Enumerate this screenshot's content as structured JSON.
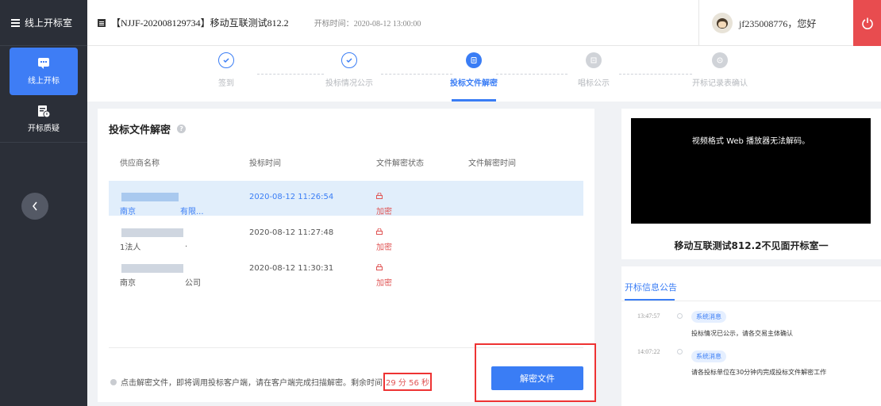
{
  "sidebar": {
    "header_label": "线上开标室",
    "items": [
      {
        "label": "线上开标"
      },
      {
        "label": "开标质疑"
      }
    ]
  },
  "topbar": {
    "project_title": "【NJJF-202008129734】移动互联测试812.2",
    "open_time_label": "开标时间：",
    "open_time_value": "2020-08-12 13:00:00",
    "user_greeting": "jf235008776，您好"
  },
  "steps": [
    {
      "label": "签到",
      "state": "done"
    },
    {
      "label": "投标情况公示",
      "state": "done"
    },
    {
      "label": "投标文件解密",
      "state": "current"
    },
    {
      "label": "唱标公示",
      "state": "todo"
    },
    {
      "label": "开标记录表确认",
      "state": "todo"
    }
  ],
  "panel": {
    "title": "投标文件解密",
    "columns": [
      "供应商名称",
      "投标时间",
      "文件解密状态",
      "文件解密时间"
    ],
    "rows": [
      {
        "name_prefix": "南京",
        "name_suffix": "有限...",
        "bid_time": "2020-08-12 11:26:54",
        "status": "加密",
        "decrypt_time": ""
      },
      {
        "name_prefix": "1法人",
        "name_suffix": ".",
        "bid_time": "2020-08-12 11:27:48",
        "status": "加密",
        "decrypt_time": ""
      },
      {
        "name_prefix": "南京",
        "name_suffix": "公司",
        "bid_time": "2020-08-12 11:30:31",
        "status": "加密",
        "decrypt_time": ""
      }
    ],
    "hint_text": "点击解密文件，即将调用投标客户端，请在客户端完成扫描解密。剩余时间",
    "countdown": "29 分 56 秒",
    "decrypt_button": "解密文件"
  },
  "video": {
    "message": "视频格式 Web 播放器无法解码。",
    "room_name": "移动互联测试812.2不见面开标室一"
  },
  "notice": {
    "tab_label": "开标信息公告",
    "messages": [
      {
        "time": "13:47:57",
        "tag": "系统消息",
        "text": "投标情况已公示，请各交易主体确认"
      },
      {
        "time": "14:07:22",
        "tag": "系统消息",
        "text": "请各投标单位在30分钟内完成投标文件解密工作"
      }
    ]
  },
  "colors": {
    "accent": "#3a7df5",
    "sidebar_bg": "#2b2f38",
    "danger": "#e84c4f"
  }
}
